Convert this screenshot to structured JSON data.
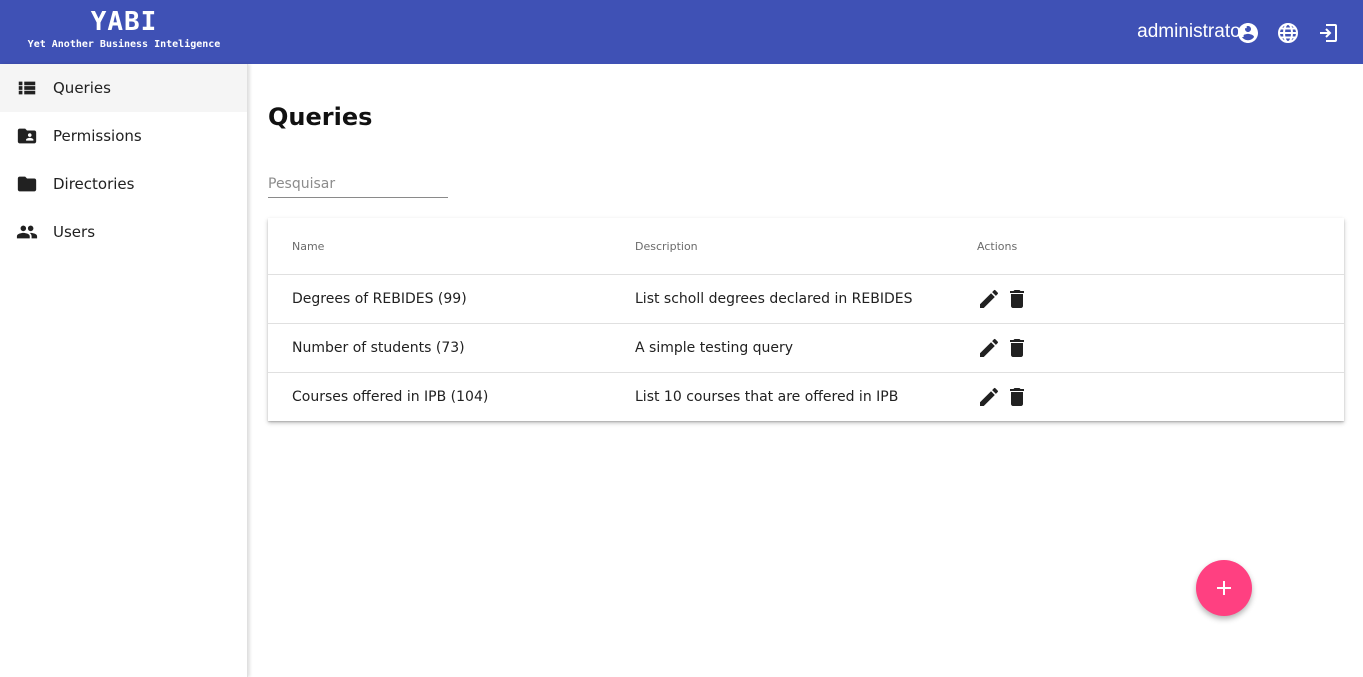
{
  "app": {
    "title": "YABI",
    "subtitle": "Yet Another Business Inteligence"
  },
  "header": {
    "username": "administrator",
    "icons": [
      "account-circle-icon",
      "globe-icon",
      "logout-icon"
    ]
  },
  "sidebar": {
    "items": [
      {
        "label": "Queries",
        "icon": "list-icon",
        "active": true
      },
      {
        "label": "Permissions",
        "icon": "folder-shared-icon",
        "active": false
      },
      {
        "label": "Directories",
        "icon": "folder-icon",
        "active": false
      },
      {
        "label": "Users",
        "icon": "people-icon",
        "active": false
      }
    ]
  },
  "main": {
    "title": "Queries",
    "search": {
      "placeholder": "Pesquisar",
      "value": ""
    },
    "table": {
      "columns": [
        "Name",
        "Description",
        "Actions"
      ],
      "rows": [
        {
          "name": "Degrees of REBIDES (99)",
          "description": "List scholl degrees declared in REBIDES"
        },
        {
          "name": "Number of students (73)",
          "description": "A simple testing query"
        },
        {
          "name": "Courses offered in IPB (104)",
          "description": "List 10 courses that are offered in IPB"
        }
      ],
      "action_icons": [
        "edit-icon",
        "delete-icon"
      ]
    }
  },
  "fab": {
    "icon": "add-icon",
    "color": "#ff4081"
  },
  "colors": {
    "primary": "#3f51b5",
    "accent": "#ff4081",
    "active_item_bg": "#f5f5f5"
  }
}
